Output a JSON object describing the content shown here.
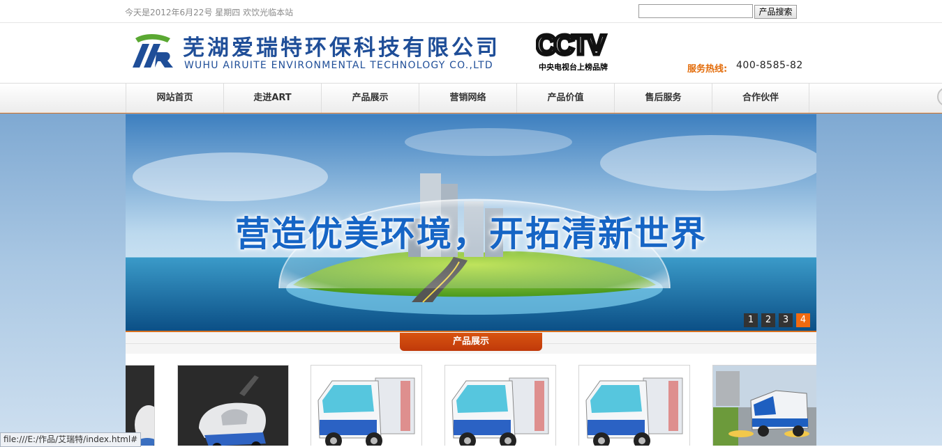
{
  "topbar": {
    "date_text": "今天是2012年6月22号  星期四  欢饮光临本站",
    "search_placeholder": "",
    "search_button": "产品搜索"
  },
  "header": {
    "company_cn": "芜湖爱瑞特环保科技有限公司",
    "company_en": "WUHU AIRUITE ENVIRONMENTAL TECHNOLOGY CO.,LTD",
    "cctv_logo": "CCTV",
    "cctv_caption": "中央电视台上榜品牌",
    "hotline_label": "服务热线:",
    "hotline_number": "400-8585-82"
  },
  "nav": {
    "items": [
      {
        "label": "网站首页"
      },
      {
        "label": "走进ART"
      },
      {
        "label": "产品展示"
      },
      {
        "label": "营销网络"
      },
      {
        "label": "产品价值"
      },
      {
        "label": "售后服务"
      },
      {
        "label": "合作伙伴"
      }
    ]
  },
  "banner": {
    "slogan": "营造优美环境，开拓清新世界",
    "dots": [
      "1",
      "2",
      "3",
      "4"
    ],
    "active_dot": "4"
  },
  "section": {
    "title": "产品展示"
  },
  "statusbar": {
    "url": "file:///E:/作品/艾瑞特/index.html#"
  },
  "colors": {
    "brand_blue": "#1f4e98",
    "accent_orange": "#d8701f",
    "tab_red": "#c8420c",
    "hotline_orange": "#e36c0a"
  }
}
